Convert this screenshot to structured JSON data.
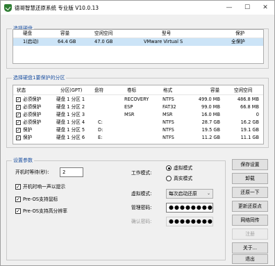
{
  "window": {
    "title": "德哥智慧还原系统 专业版 V10.0.13",
    "minimize": "—",
    "maximize": "☐",
    "close": "✕"
  },
  "disks": {
    "group_title": "选择硬盘",
    "headers": [
      "硬盘",
      "容量",
      "空闲空间",
      "型号",
      "保护"
    ],
    "rows": [
      {
        "disk": "1(启动)",
        "capacity": "64.4 GB",
        "free": "47.0 GB",
        "model": "VMware Virtual S",
        "protect": "全保护"
      }
    ]
  },
  "partitions": {
    "group_title": "选择硬盘1要保护的分区",
    "headers": [
      "状态",
      "分区(GPT)",
      "盘符",
      "卷标",
      "格式",
      "容量",
      "空闲空间"
    ],
    "rows": [
      {
        "checked": true,
        "status": "必须保护",
        "part": "硬盘 1 分区 1",
        "letter": "",
        "label": "RECOVERY",
        "fs": "NTFS",
        "size": "499.0 MB",
        "free": "486.8 MB"
      },
      {
        "checked": true,
        "status": "必须保护",
        "part": "硬盘 1 分区 2",
        "letter": "",
        "label": "ESP",
        "fs": "FAT32",
        "size": "99.0 MB",
        "free": "66.8 MB"
      },
      {
        "checked": true,
        "status": "必须保护",
        "part": "硬盘 1 分区 3",
        "letter": "",
        "label": "MSR",
        "fs": "MSR",
        "size": "16.0 MB",
        "free": "0"
      },
      {
        "checked": true,
        "status": "必须保护",
        "part": "硬盘 1 分区 4",
        "letter": "C:",
        "label": "",
        "fs": "NTFS",
        "size": "28.7 GB",
        "free": "16.2 GB"
      },
      {
        "checked": true,
        "status": "保护",
        "part": "硬盘 1 分区 5",
        "letter": "D:",
        "label": "",
        "fs": "NTFS",
        "size": "19.5 GB",
        "free": "19.1 GB"
      },
      {
        "checked": true,
        "status": "保护",
        "part": "硬盘 1 分区 6",
        "letter": "E:",
        "label": "",
        "fs": "NTFS",
        "size": "11.2 GB",
        "free": "11.1 GB"
      }
    ]
  },
  "settings": {
    "group_title": "设置参数",
    "boot_wait_label": "开机时等待(秒):",
    "boot_wait_value": "2",
    "beep_label": "开机时响一声以提示",
    "preos_mouse_label": "Pre-OS支持鼠标",
    "preos_hires_label": "Pre-OS支持高分辨率",
    "beep_checked": true,
    "preos_mouse_checked": true,
    "preos_hires_checked": true,
    "work_mode_label": "工作模式:",
    "mode_virtual": "虚拟模式",
    "mode_real": "真实模式",
    "virtual_mode_label": "虚拟模式:",
    "virtual_mode_value": "每次启动还原",
    "admin_pw_label": "管理密码:",
    "admin_pw_value": "●●●●●●●●",
    "confirm_pw_label": "确认密码:",
    "confirm_pw_value": "●●●●●●●●"
  },
  "buttons": {
    "save": "保存设置",
    "uninstall": "卸载",
    "restore_once": "还原一下",
    "update_point": "更新还原点",
    "network": "网络同传",
    "register": "注册",
    "about": "关于...",
    "exit": "退出"
  }
}
